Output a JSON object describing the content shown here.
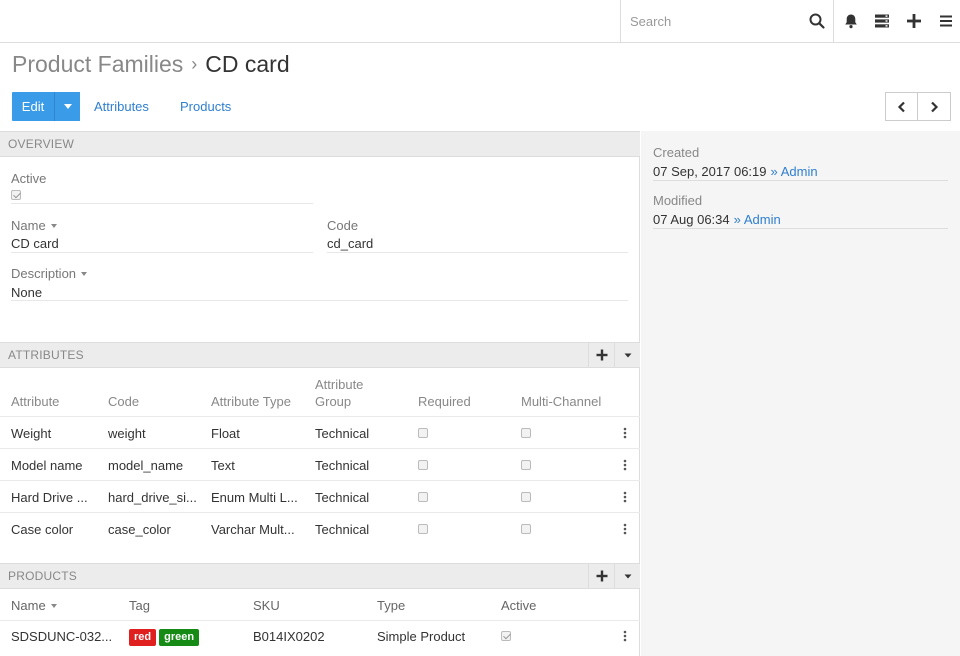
{
  "topbar": {
    "search_placeholder": "Search"
  },
  "header": {
    "breadcrumb_parent": "Product Families",
    "breadcrumb_separator": "›",
    "title": "CD card",
    "edit_label": "Edit",
    "links": [
      "Attributes",
      "Products"
    ]
  },
  "overview": {
    "title": "OVERVIEW",
    "active_label": "Active",
    "active_checked": true,
    "name_label": "Name",
    "name_value": "CD card",
    "code_label": "Code",
    "code_value": "cd_card",
    "description_label": "Description",
    "description_value": "None"
  },
  "attributes": {
    "title": "ATTRIBUTES",
    "columns": [
      "Attribute",
      "Code",
      "Attribute Type",
      "Attribute Group",
      "Required",
      "Multi-Channel"
    ],
    "rows": [
      {
        "attribute": "Weight",
        "code": "weight",
        "type": "Float",
        "group": "Technical",
        "required": false,
        "multichannel": false
      },
      {
        "attribute": "Model name",
        "code": "model_name",
        "type": "Text",
        "group": "Technical",
        "required": false,
        "multichannel": false
      },
      {
        "attribute": "Hard Drive ...",
        "code": "hard_drive_si...",
        "type": "Enum Multi L...",
        "group": "Technical",
        "required": false,
        "multichannel": false
      },
      {
        "attribute": "Case color",
        "code": "case_color",
        "type": "Varchar Mult...",
        "group": "Technical",
        "required": false,
        "multichannel": false
      }
    ]
  },
  "products": {
    "title": "PRODUCTS",
    "columns": [
      "Name",
      "Tag",
      "SKU",
      "Type",
      "Active"
    ],
    "rows": [
      {
        "name": "SDSDUNC-032...",
        "tags": [
          "red",
          "green"
        ],
        "sku": "B014IX0202",
        "type": "Simple Product",
        "active": true
      }
    ]
  },
  "meta": {
    "created_label": "Created",
    "created_value": "07 Sep, 2017 06:19",
    "created_by": "Admin",
    "modified_label": "Modified",
    "modified_value": "07 Aug 06:34",
    "modified_by": "Admin",
    "by_separator": "»"
  },
  "colors": {
    "accent": "#3a9ce8",
    "link": "#2f7fd0",
    "tag_red": "#e01f1f",
    "tag_green": "#158a15"
  }
}
